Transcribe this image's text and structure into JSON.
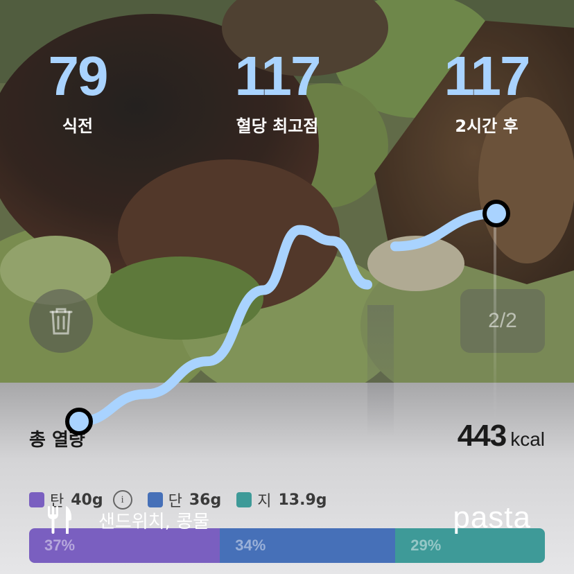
{
  "stats": [
    {
      "value": "79",
      "label": "식전"
    },
    {
      "value": "117",
      "label": "혈당 최고점"
    },
    {
      "value": "117",
      "label": "2시간 후"
    }
  ],
  "pager": "2/2",
  "total": {
    "label": "총 열량",
    "value": "443",
    "unit": "kcal"
  },
  "macros": [
    {
      "key": "탄",
      "value": "40g",
      "color": "#7a5fc0"
    },
    {
      "key": "단",
      "value": "36g",
      "color": "#4670b8"
    },
    {
      "key": "지",
      "value": "13.9g",
      "color": "#3e9a98"
    }
  ],
  "info_glyph": "i",
  "food": {
    "icon": "utensils-icon",
    "name": "샌드위치, 콩물"
  },
  "brand": "pasta",
  "ratio_bar": [
    {
      "label": "37%",
      "fraction": 0.37,
      "color": "#7a5fc0"
    },
    {
      "label": "34%",
      "fraction": 0.34,
      "color": "#4670b8"
    },
    {
      "label": "29%",
      "fraction": 0.29,
      "color": "#3e9a98"
    }
  ],
  "chart_data": {
    "type": "line",
    "series": [
      {
        "values": [
          79,
          84,
          90,
          103,
          114,
          112,
          104,
          111,
          117
        ]
      }
    ],
    "start_value": 79,
    "peak_value": 117,
    "end_value": 117,
    "line_color": "#a9d3ff"
  }
}
